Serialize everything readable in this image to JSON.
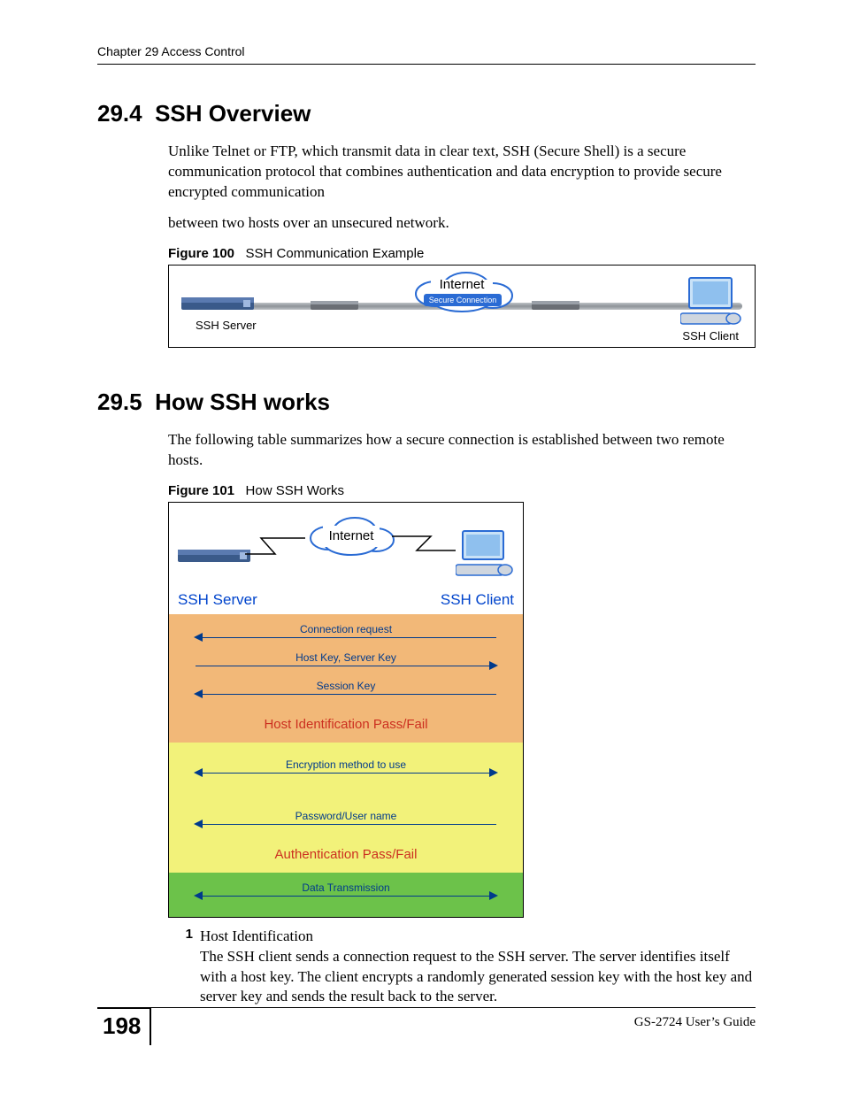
{
  "header": {
    "chapter_line": "Chapter 29 Access Control"
  },
  "section1": {
    "number": "29.4",
    "title": "SSH Overview",
    "para1": "Unlike Telnet or FTP, which transmit data in clear text, SSH (Secure Shell) is a secure communication protocol that combines authentication and data encryption to provide secure encrypted communication",
    "para2": "between two hosts over an unsecured network."
  },
  "figure100": {
    "label_bold": "Figure 100",
    "label_rest": "SSH Communication Example",
    "cloud_label": "Internet",
    "secure_label": "Secure Connection",
    "server_label": "SSH Server",
    "client_label": "SSH Client"
  },
  "section2": {
    "number": "29.5",
    "title": "How SSH works",
    "para1": "The following table summarizes how a secure connection is established between two remote hosts."
  },
  "figure101": {
    "label_bold": "Figure 101",
    "label_rest": "How SSH Works",
    "cloud_label": "Internet",
    "server_header": "SSH Server",
    "client_header": "SSH Client",
    "orange": {
      "row1": "Connection request",
      "row2": "Host Key, Server Key",
      "row3": "Session Key",
      "pass": "Host Identification Pass/Fail"
    },
    "yellow": {
      "row1": "Encryption method to use",
      "row2": "Password/User name",
      "pass": "Authentication Pass/Fail"
    },
    "green": {
      "row1": "Data Transmission"
    }
  },
  "list": {
    "num": "1",
    "head": "Host Identification",
    "body": "The SSH client sends a connection request to the SSH server. The server identifies itself with a host key. The client encrypts a randomly generated session key with the host key and server key and sends the result back to the server."
  },
  "footer": {
    "page": "198",
    "guide": "GS-2724 User’s Guide"
  }
}
